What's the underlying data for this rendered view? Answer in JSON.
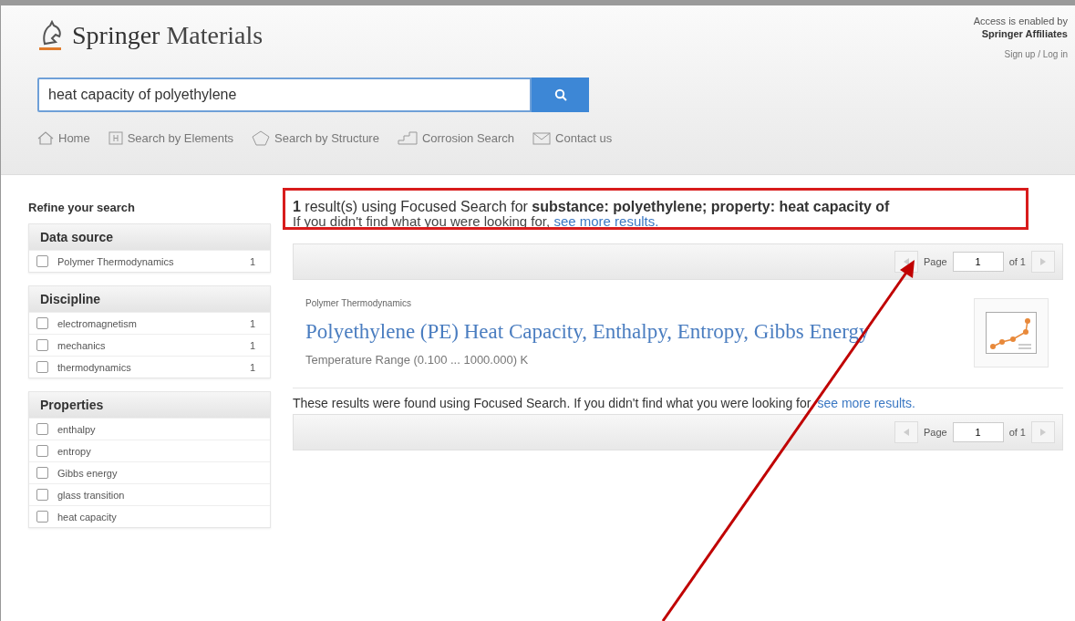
{
  "header": {
    "logo_text_bold": "Springer",
    "logo_text": "Materials",
    "access_line1": "Access is enabled by",
    "access_line2": "Springer Affiliates",
    "signup": "Sign up / Log in"
  },
  "search": {
    "value": "heat capacity of polyethylene"
  },
  "nav": [
    {
      "kind": "home",
      "label": "Home"
    },
    {
      "kind": "elements",
      "label": "Search by Elements"
    },
    {
      "kind": "structure",
      "label": "Search by Structure"
    },
    {
      "kind": "corrosion",
      "label": "Corrosion Search"
    },
    {
      "kind": "contact",
      "label": "Contact us"
    }
  ],
  "sidebar": {
    "title": "Refine your search",
    "groups": [
      {
        "title": "Data source",
        "items": [
          {
            "label": "Polymer Thermodynamics",
            "count": "1",
            "checked": false
          }
        ]
      },
      {
        "title": "Discipline",
        "items": [
          {
            "label": "electromagnetism",
            "count": "1",
            "checked": false
          },
          {
            "label": "mechanics",
            "count": "1",
            "checked": false
          },
          {
            "label": "thermodynamics",
            "count": "1",
            "checked": false
          }
        ]
      },
      {
        "title": "Properties",
        "items": [
          {
            "label": "enthalpy",
            "checked": false
          },
          {
            "label": "entropy",
            "checked": false
          },
          {
            "label": "Gibbs energy",
            "checked": false
          },
          {
            "label": "glass transition",
            "checked": false
          },
          {
            "label": "heat capacity",
            "checked": false
          }
        ]
      }
    ]
  },
  "results": {
    "summary": "**1** result(s) using Focused Search for **substance: polyethylene; property: heat capacity** **of**",
    "hint": "If you didn't find what you were looking for,",
    "hint_link": "see more results.",
    "pager_top": {
      "label": "Page",
      "value": "1",
      "of": "of 1"
    },
    "items": [
      {
        "source": "Polymer Thermodynamics",
        "title": "Polyethylene (PE) Heat Capacity, Enthalpy, Entropy, Gibbs Energy",
        "range": "Temperature Range (0.100 ... 1000.000) K"
      }
    ],
    "footer": "These results were found using Focused Search. If you didn't find what you were looking for,",
    "footer_link": "see more results.",
    "pager_bottom": {
      "label": "Page",
      "value": "1",
      "of": "of 1"
    }
  }
}
